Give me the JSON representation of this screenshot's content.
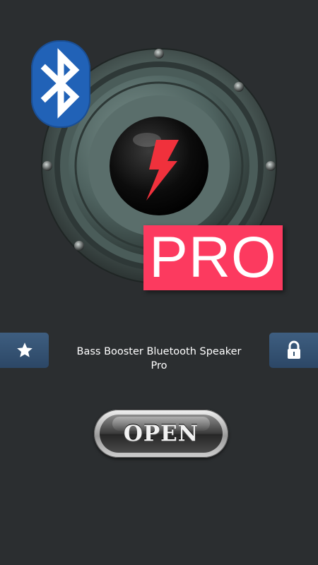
{
  "app": {
    "title": "Bass Booster Bluetooth Speaker Pro",
    "badge_text": "PRO"
  },
  "buttons": {
    "open_label": "OPEN",
    "star_icon": "star-icon",
    "lock_icon": "lock-icon"
  },
  "colors": {
    "background": "#2b2e30",
    "pro_badge": "#fc3a5f",
    "bluetooth_badge": "#2162b7",
    "side_button": "#35536f",
    "bolt": "#f0313c"
  }
}
